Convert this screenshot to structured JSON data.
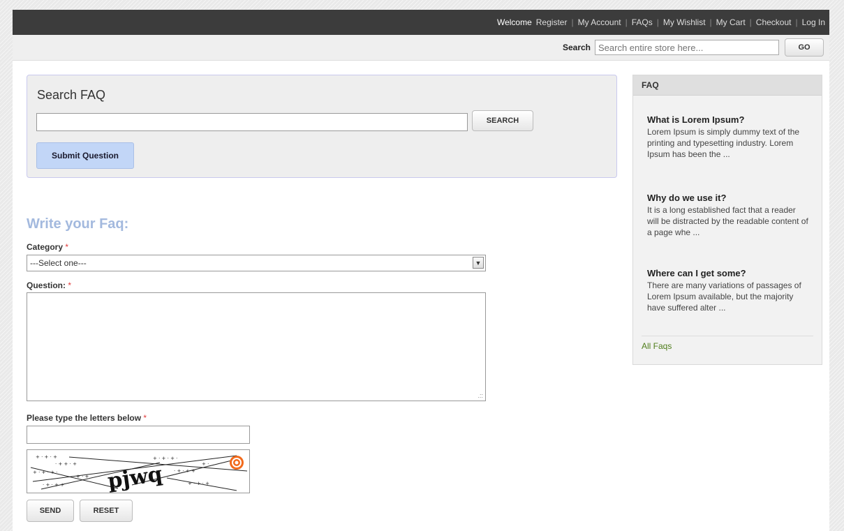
{
  "topbar": {
    "welcome": "Welcome",
    "links": [
      "Register",
      "My Account",
      "FAQs",
      "My Wishlist",
      "My Cart",
      "Checkout",
      "Log In"
    ]
  },
  "store_search": {
    "label": "Search",
    "placeholder": "Search entire store here...",
    "button": "GO"
  },
  "search_faq": {
    "title": "Search FAQ",
    "input_value": "",
    "search_button": "SEARCH",
    "submit_button": "Submit Question"
  },
  "write_faq": {
    "title": "Write your Faq:",
    "category_label": "Category",
    "category_selected": "---Select one---",
    "question_label": "Question:",
    "question_value": "",
    "captcha_label": "Please type the letters below",
    "captcha_value": "",
    "captcha_text": "pjwq",
    "send_button": "SEND",
    "reset_button": "RESET",
    "required_mark": "*"
  },
  "sidebar": {
    "title": "FAQ",
    "items": [
      {
        "question": "What is Lorem Ipsum?",
        "answer": "Lorem Ipsum is simply dummy text of the printing and typesetting industry. Lorem Ipsum has been the ..."
      },
      {
        "question": "Why do we use it?",
        "answer": "It is a long established fact that a reader will be distracted by the readable content of a page whe ..."
      },
      {
        "question": "Where can I get some?",
        "answer": "There are many variations of passages of Lorem Ipsum available, but the majority have suffered alter ..."
      }
    ],
    "all_link": "All Faqs"
  },
  "colors": {
    "topbar_bg": "#3c3c3c",
    "write_title": "#a3b9de",
    "submit_bg": "#c2d6f7",
    "link_green": "#4f7d1b",
    "required_red": "#e03a3a"
  }
}
